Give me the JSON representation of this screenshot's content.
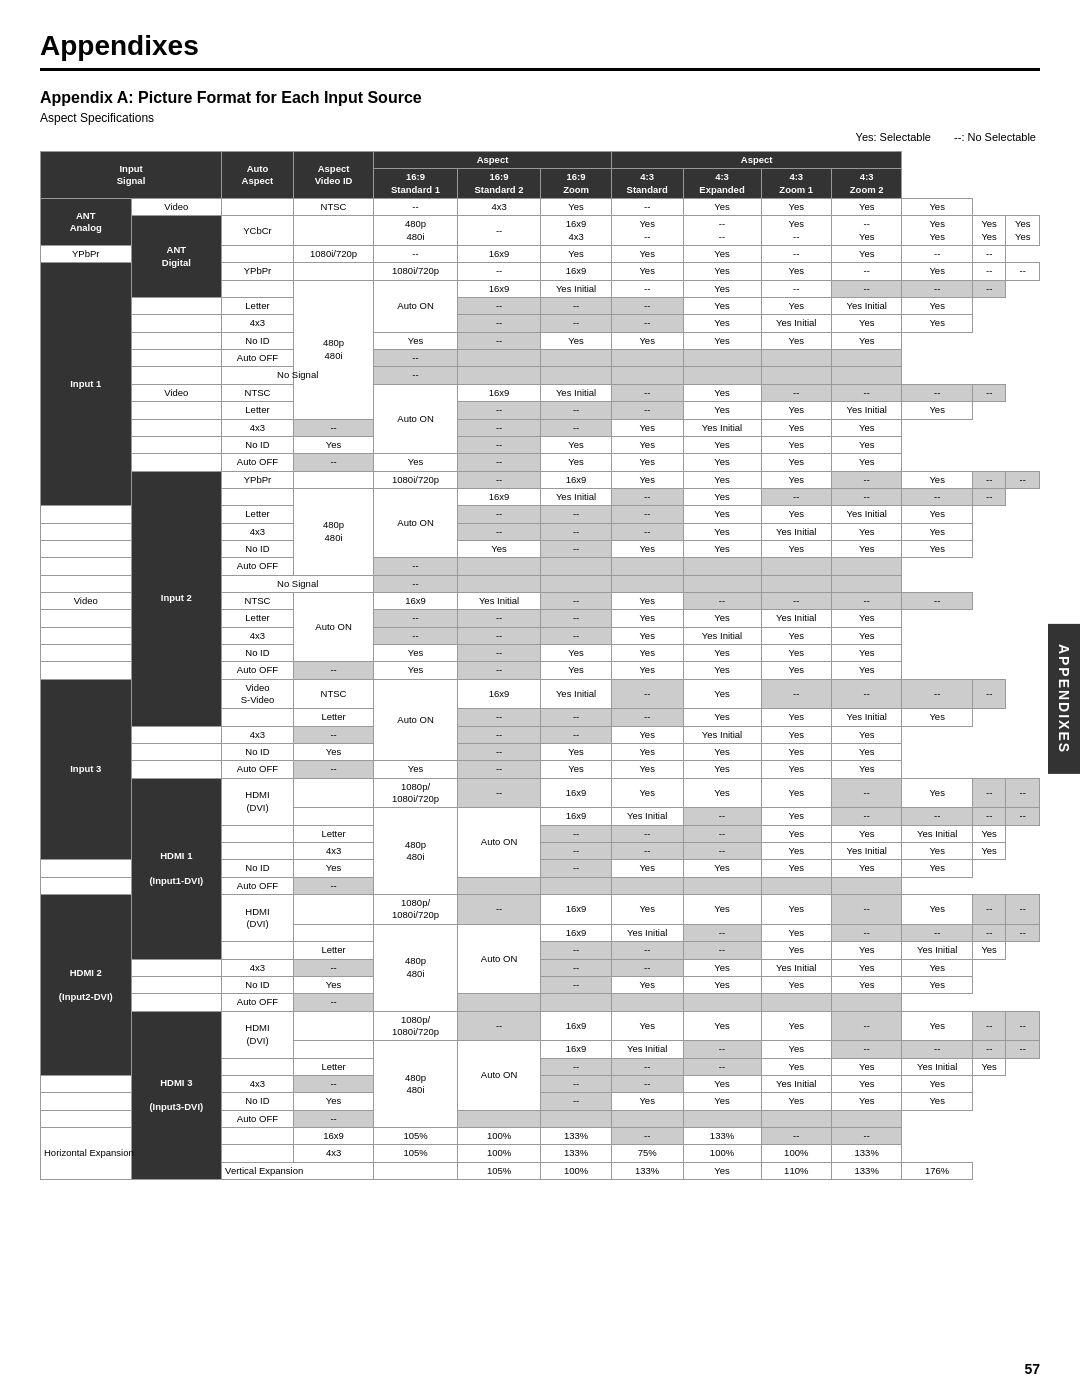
{
  "page": {
    "title": "Appendixes",
    "section": "Appendix A:  Picture Format for Each Input Source",
    "sub": "Aspect Specifications",
    "legend_yes": "Yes: Selectable",
    "legend_no": "--: No Selectable",
    "page_number": "57",
    "side_tab": "APPENDIXES"
  },
  "table": {
    "headers": {
      "input_signal": "Input\nSignal",
      "auto_aspect": "Auto\nAspect",
      "aspect_video_id": "Aspect\nVideo ID",
      "col_169_std1": "16:9\nStandard 1",
      "col_169_std2": "16:9\nStandard 2",
      "col_169_zoom": "16:9\nZoom",
      "col_43_std": "4:3\nStandard",
      "col_43_exp": "4:3\nExpanded",
      "col_43_z1": "4:3\nZoom 1",
      "col_43_z2": "4:3\nZoom 2"
    }
  }
}
